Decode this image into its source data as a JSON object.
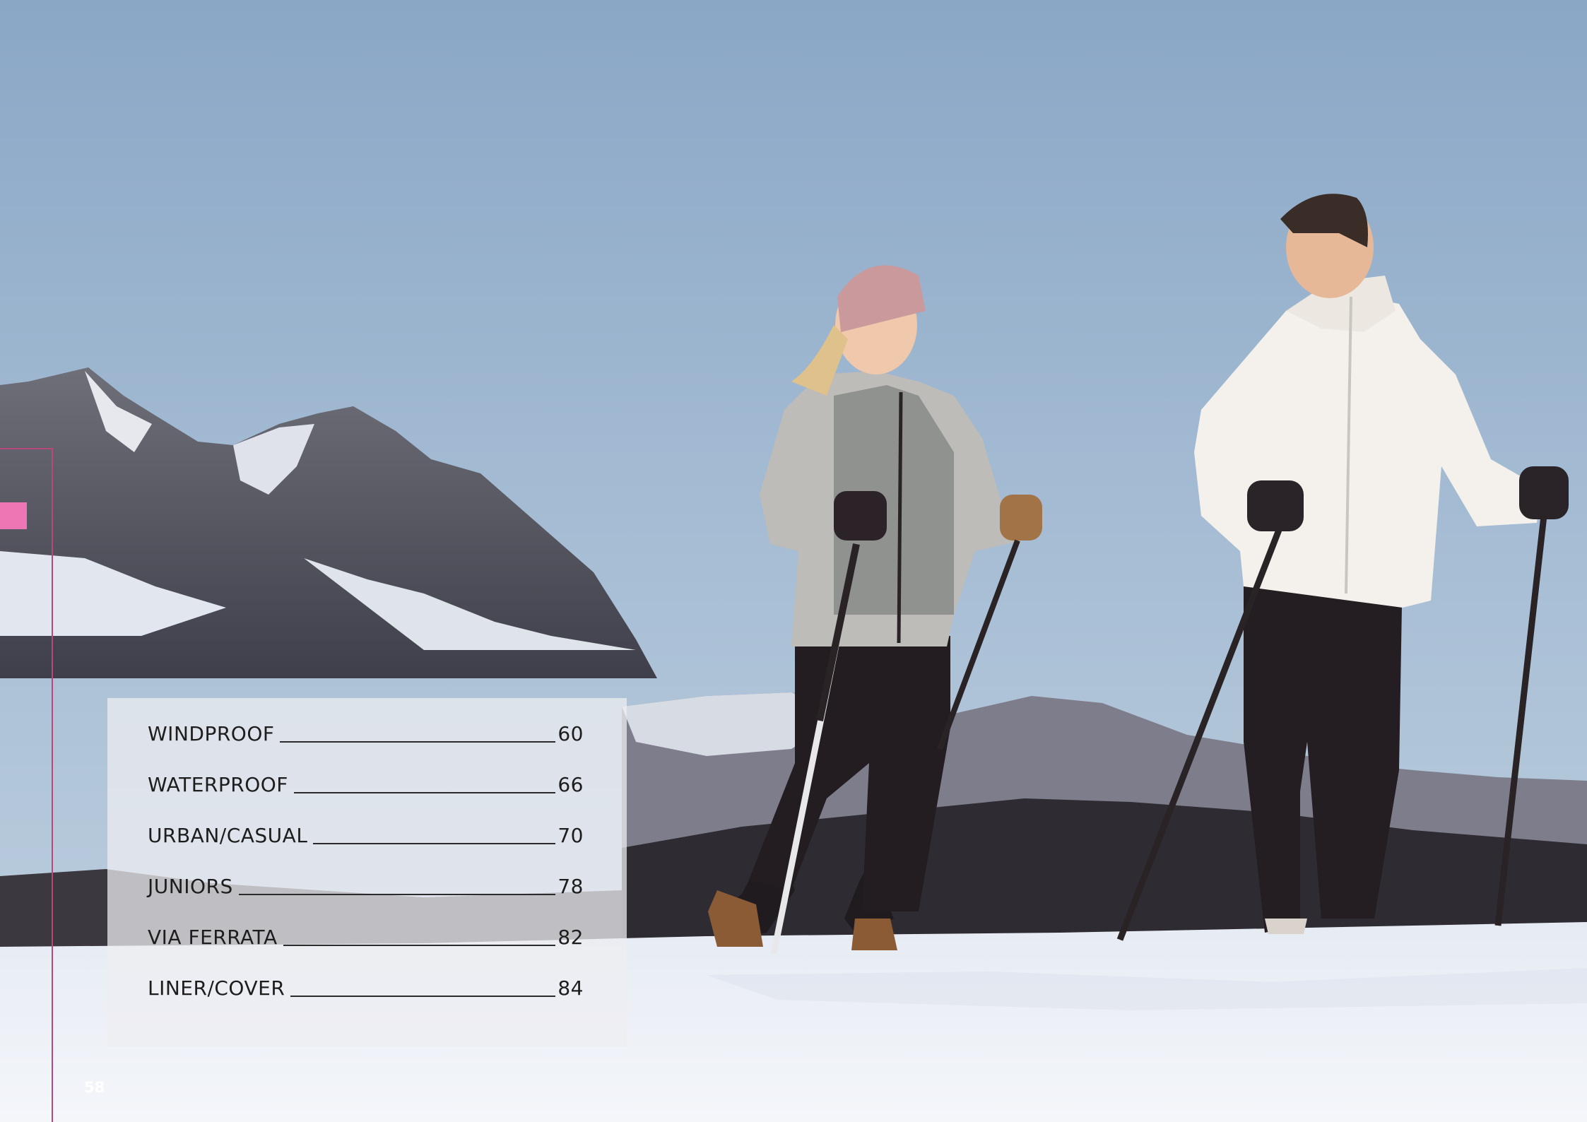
{
  "toc": {
    "entries": [
      {
        "label": "WINDPROOF",
        "page": "60"
      },
      {
        "label": "WATERPROOF",
        "page": "66"
      },
      {
        "label": "URBAN/CASUAL",
        "page": "70"
      },
      {
        "label": "JUNIORS",
        "page": "78"
      },
      {
        "label": "VIA FERRATA",
        "page": "82"
      },
      {
        "label": "LINER/COVER",
        "page": "84"
      }
    ]
  },
  "page_number": "58",
  "colors": {
    "accent_pink": "#ef76b5",
    "margin_line": "#b8487a",
    "sky": "#9fb6cc",
    "snow": "#eef1f6"
  }
}
